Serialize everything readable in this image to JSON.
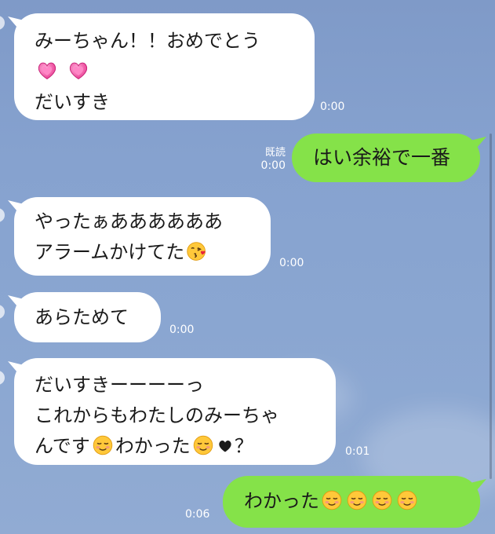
{
  "messages": [
    {
      "direction": "incoming",
      "lines": [
        "みーちゃん！！おめでとう",
        "",
        "だいすき"
      ],
      "emoji_line2": [
        "heart-emoji",
        "heart-emoji"
      ],
      "time": "0:00"
    },
    {
      "direction": "outgoing",
      "lines": [
        "はい余裕で一番"
      ],
      "read": "既読",
      "time": "0:00"
    },
    {
      "direction": "incoming",
      "lines": [
        "やったぁああああああ",
        "アラームかけてた"
      ],
      "emoji_line2": [
        "kiss-emoji"
      ],
      "time": "0:00"
    },
    {
      "direction": "incoming",
      "lines": [
        "あらためて"
      ],
      "time": "0:00"
    },
    {
      "direction": "incoming",
      "lines": [
        "だいすきーーーーっ",
        "これからもわたしのみーちゃ",
        "んです",
        "わかった",
        "？"
      ],
      "emoji_line3": [
        "smiling-emoji",
        "smiling-emoji",
        "black-heart"
      ],
      "time": "0:01"
    },
    {
      "direction": "outgoing",
      "lines": [
        "わかった"
      ],
      "emoji_line1": [
        "smiling-emoji",
        "smiling-emoji",
        "smiling-emoji",
        "smiling-emoji"
      ],
      "time": "0:06"
    }
  ],
  "colors": {
    "incoming_bubble": "#ffffff",
    "outgoing_bubble": "#85e249",
    "background": "#86a2cf",
    "timestamp": "#ffffff"
  }
}
